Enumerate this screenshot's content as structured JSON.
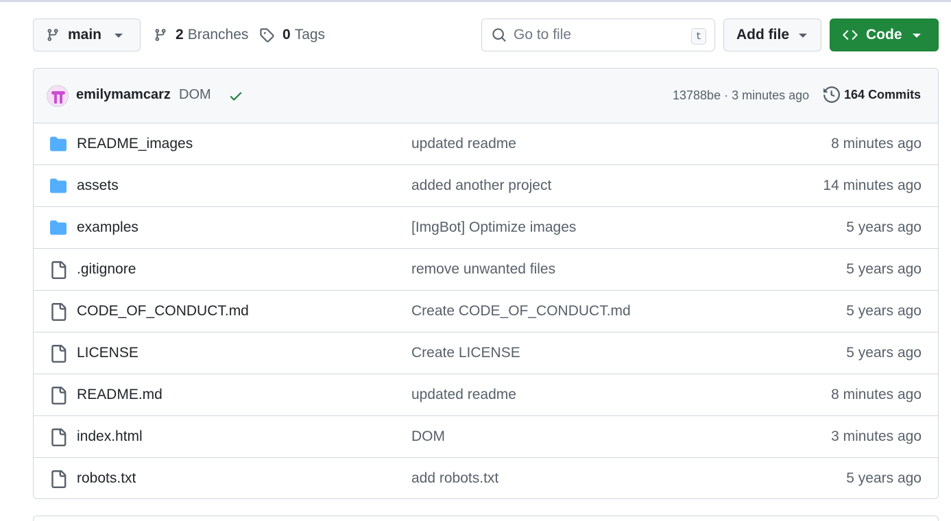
{
  "toolbar": {
    "branch_label": "main",
    "branches_count": "2",
    "branches_label": "Branches",
    "tags_count": "0",
    "tags_label": "Tags",
    "search_placeholder": "Go to file",
    "search_shortcut": "t",
    "add_file_label": "Add file",
    "code_label": "Code"
  },
  "latest_commit": {
    "author": "emilymamcarz",
    "message": "DOM",
    "hash_time": "13788be · 3 minutes ago",
    "commits_count": "164",
    "commits_label": "Commits"
  },
  "files": [
    {
      "type": "folder",
      "name": "README_images",
      "message": "updated readme",
      "time": "8 minutes ago"
    },
    {
      "type": "folder",
      "name": "assets",
      "message": "added another project",
      "time": "14 minutes ago"
    },
    {
      "type": "folder",
      "name": "examples",
      "message": "[ImgBot] Optimize images",
      "time": "5 years ago"
    },
    {
      "type": "file",
      "name": ".gitignore",
      "message": "remove unwanted files",
      "time": "5 years ago"
    },
    {
      "type": "file",
      "name": "CODE_OF_CONDUCT.md",
      "message": "Create CODE_OF_CONDUCT.md",
      "time": "5 years ago"
    },
    {
      "type": "file",
      "name": "LICENSE",
      "message": "Create LICENSE",
      "time": "5 years ago"
    },
    {
      "type": "file",
      "name": "README.md",
      "message": "updated readme",
      "time": "8 minutes ago"
    },
    {
      "type": "file",
      "name": "index.html",
      "message": "DOM",
      "time": "3 minutes ago"
    },
    {
      "type": "file",
      "name": "robots.txt",
      "message": "add robots.txt",
      "time": "5 years ago"
    }
  ],
  "colors": {
    "primary_button": "#1f883d",
    "folder_icon": "#54aeff",
    "check_icon": "#1a7f37",
    "avatar": "#c94fd0"
  }
}
